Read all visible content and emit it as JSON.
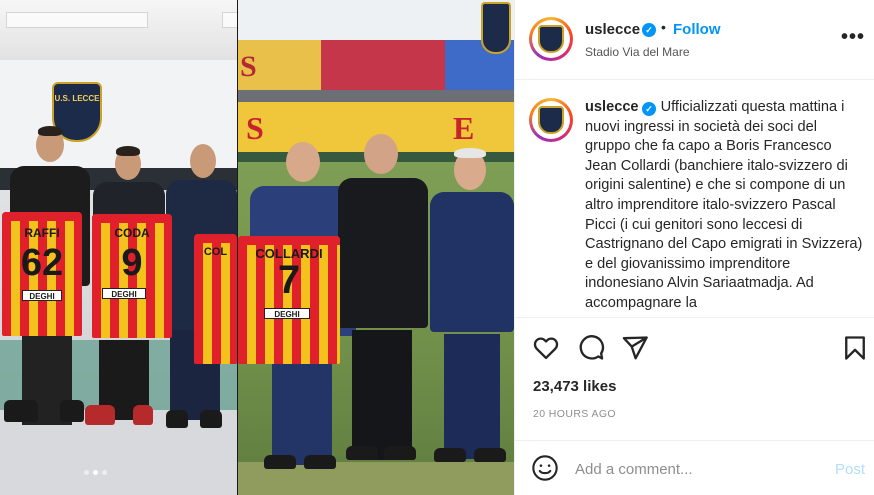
{
  "post": {
    "username": "uslecce",
    "verified_mark": "✓",
    "separator": "•",
    "follow_label": "Follow",
    "location": "Stadio Via del Mare",
    "caption": "Ufficializzati questa mattina i nuovi ingressi in società dei soci del gruppo che fa capo a Boris Francesco Jean Collardi (banchiere italo-svizzero di origini salentine) e che si compone di un altro imprenditore italo-svizzero Pascal Picci (i cui genitori sono leccesi di Castrignano del Capo emigrati in Svizzera) e del giovanissimo imprenditore indonesiano Alvin Sariaatmadja. Ad accompagnare la",
    "likes": "23,473 likes",
    "time_ago": "20 HOURS AGO"
  },
  "comment": {
    "placeholder": "Add a comment...",
    "post_label": "Post"
  },
  "media": {
    "crest_text": "U.S. LECCE",
    "jerseys": [
      {
        "name": "RAFFI",
        "number": "62",
        "sponsor": "DEGHI"
      },
      {
        "name": "CODA",
        "number": "9",
        "sponsor": "DEGHI"
      },
      {
        "name": "COL",
        "number": "",
        "sponsor": ""
      },
      {
        "name": "COLLARDI",
        "number": "7",
        "sponsor": "DEGHI"
      }
    ],
    "stand_letters": [
      "S",
      "S",
      "E"
    ],
    "carousel": {
      "count": 3,
      "active": 2
    }
  },
  "icons": [
    "heart-icon",
    "comment-icon",
    "share-icon",
    "bookmark-icon",
    "emoji-icon",
    "more-options-icon",
    "verified-icon"
  ],
  "colors": {
    "accent": "#0095f6",
    "post_disabled": "#b2dffc",
    "jersey_red": "#e0202b",
    "jersey_yellow": "#f4c21c"
  }
}
